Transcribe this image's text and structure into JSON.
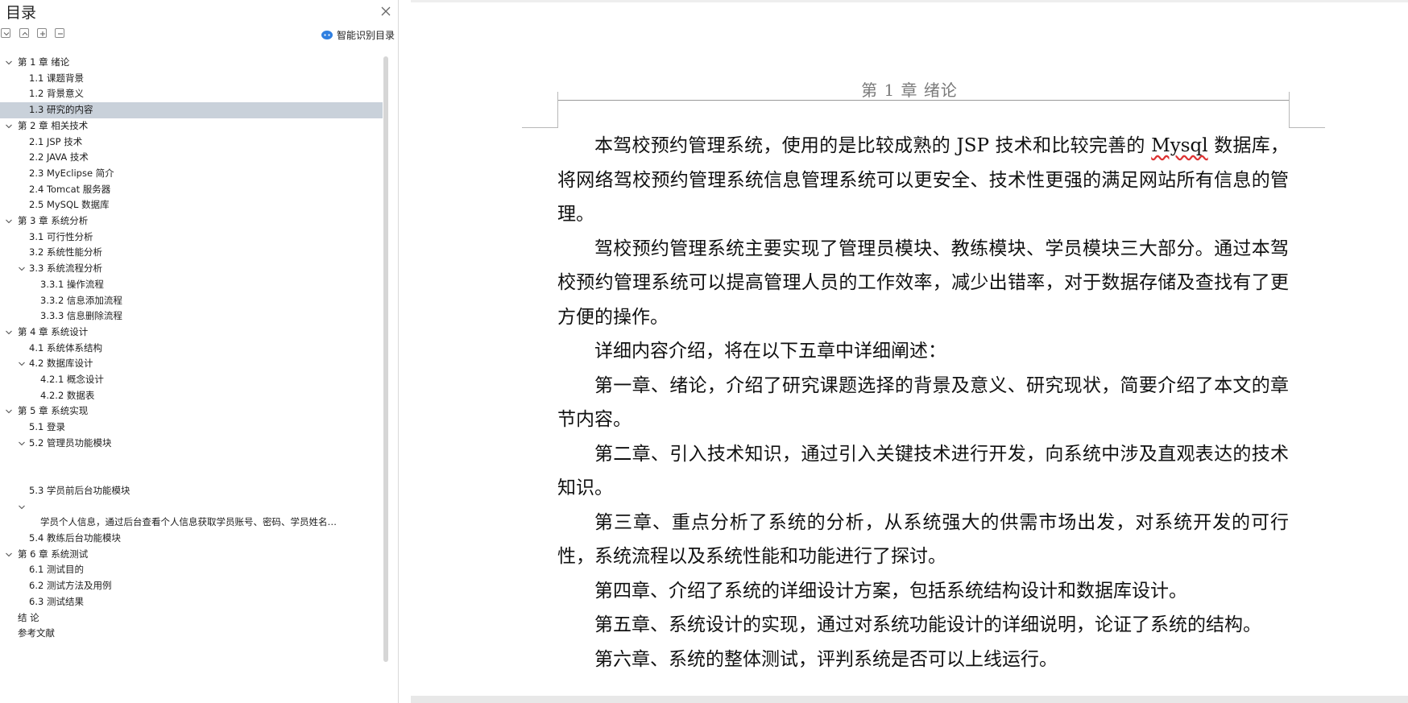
{
  "sidebar": {
    "title": "目录",
    "smart_button_label": "智能识别目录",
    "toc": [
      {
        "level": 0,
        "label": "第 1 章 绪论",
        "expanded": true
      },
      {
        "level": 1,
        "label": "1.1 课题背景"
      },
      {
        "level": 1,
        "label": "1.2 背景意义"
      },
      {
        "level": 1,
        "label": "1.3 研究的内容",
        "selected": true
      },
      {
        "level": 0,
        "label": "第 2 章 相关技术",
        "expanded": true
      },
      {
        "level": 1,
        "label": "2.1 JSP 技术"
      },
      {
        "level": 1,
        "label": "2.2 JAVA 技术"
      },
      {
        "level": 1,
        "label": "2.3 MyEclipse 简介"
      },
      {
        "level": 1,
        "label": "2.4 Tomcat 服务器"
      },
      {
        "level": 1,
        "label": "2.5 MySQL 数据库"
      },
      {
        "level": 0,
        "label": "第 3 章 系统分析",
        "expanded": true
      },
      {
        "level": 1,
        "label": "3.1 可行性分析"
      },
      {
        "level": 1,
        "label": "3.2 系统性能分析"
      },
      {
        "level": 1,
        "label": "3.3 系统流程分析",
        "expanded": true
      },
      {
        "level": 2,
        "label": "3.3.1 操作流程"
      },
      {
        "level": 2,
        "label": "3.3.2 信息添加流程"
      },
      {
        "level": 2,
        "label": "3.3.3 信息删除流程"
      },
      {
        "level": 0,
        "label": "第 4 章 系统设计",
        "expanded": true
      },
      {
        "level": 1,
        "label": "4.1 系统体系结构"
      },
      {
        "level": 1,
        "label": "4.2 数据库设计",
        "expanded": true
      },
      {
        "level": 2,
        "label": "4.2.1 概念设计"
      },
      {
        "level": 2,
        "label": "4.2.2 数据表"
      },
      {
        "level": 0,
        "label": "第 5 章 系统实现",
        "expanded": true
      },
      {
        "level": 1,
        "label": "5.1 登录"
      },
      {
        "level": 1,
        "label": "5.2 管理员功能模块",
        "expanded": true
      },
      {
        "level": 1,
        "label": ""
      },
      {
        "level": 1,
        "label": ""
      },
      {
        "level": 1,
        "label": "5.3 学员前后台功能模块"
      },
      {
        "level": 1,
        "label": "",
        "expanded": true
      },
      {
        "level": 2,
        "label": "学员个人信息，通过后台查看个人信息获取学员账号、密码、学员姓名、性别、年龄、手机"
      },
      {
        "level": 1,
        "label": "5.4 教练后台功能模块"
      },
      {
        "level": 0,
        "label": "第 6 章 系统测试",
        "expanded": true
      },
      {
        "level": 1,
        "label": "6.1 测试目的"
      },
      {
        "level": 1,
        "label": "6.2 测试方法及用例"
      },
      {
        "level": 1,
        "label": "6.3 测试结果"
      },
      {
        "level": 0,
        "label": "结 论"
      },
      {
        "level": 0,
        "label": "参考文献"
      }
    ]
  },
  "document": {
    "header": "第 1 章 绪论",
    "paragraphs": [
      "本驾校预约管理系统，使用的是比较成熟的 JSP 技术和比较完善的 Mysql 数据库，将网络驾校预约管理系统信息管理系统可以更安全、技术性更强的满足网站所有信息的管理。",
      "驾校预约管理系统主要实现了管理员模块、教练模块、学员模块三大部分。通过本驾校预约管理系统可以提高管理人员的工作效率，减少出错率，对于数据存储及查找有了更方便的操作。",
      "详细内容介绍，将在以下五章中详细阐述：",
      "第一章、绪论，介绍了研究课题选择的背景及意义、研究现状，简要介绍了本文的章节内容。",
      "第二章、引入技术知识，通过引入关键技术进行开发，向系统中涉及直观表达的技术知识。",
      "第三章、重点分析了系统的分析，从系统强大的供需市场出发，对系统开发的可行性，系统流程以及系统性能和功能进行了探讨。",
      "第四章、介绍了系统的详细设计方案，包括系统结构设计和数据库设计。",
      "第五章、系统设计的实现，通过对系统功能设计的详细说明，论证了系统的结构。",
      "第六章、系统的整体测试，评判系统是否可以上线运行。"
    ],
    "underlined_word": "Mysql"
  },
  "colors": {
    "selected_row": "#c9d1da",
    "header_text": "#7a7a7a",
    "ai_icon": "#2f7fe0"
  }
}
